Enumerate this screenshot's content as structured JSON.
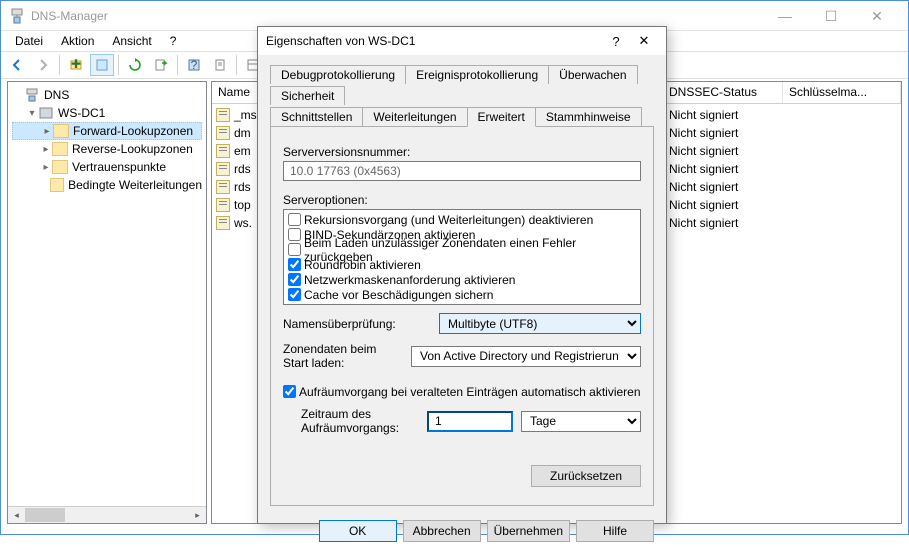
{
  "window": {
    "title": "DNS-Manager",
    "menu": [
      "Datei",
      "Aktion",
      "Ansicht",
      "?"
    ]
  },
  "tree": {
    "root": "DNS",
    "server": "WS-DC1",
    "nodes": [
      {
        "label": "Forward-Lookupzonen",
        "selected": true
      },
      {
        "label": "Reverse-Lookupzonen"
      },
      {
        "label": "Vertrauenspunkte"
      },
      {
        "label": "Bedingte Weiterleitungen"
      }
    ]
  },
  "middle": {
    "header": "Name",
    "rows": [
      "_ms",
      "dm",
      "em",
      "rds",
      "rds",
      "top",
      "ws."
    ]
  },
  "right": {
    "col1": "DNSSEC-Status",
    "col2": "Schlüsselma...",
    "rows": [
      "Nicht signiert",
      "Nicht signiert",
      "Nicht signiert",
      "Nicht signiert",
      "Nicht signiert",
      "Nicht signiert",
      "Nicht signiert"
    ]
  },
  "dialog": {
    "title": "Eigenschaften von WS-DC1",
    "tabs_row1": [
      "Debugprotokollierung",
      "Ereignisprotokollierung",
      "Überwachen",
      "Sicherheit"
    ],
    "tabs_row2": [
      "Schnittstellen",
      "Weiterleitungen",
      "Erweitert",
      "Stammhinweise"
    ],
    "active_tab": "Erweitert",
    "version_label": "Serverversionsnummer:",
    "version_value": "10.0 17763 (0x4563)",
    "options_label": "Serveroptionen:",
    "options": [
      {
        "label": "Rekursionsvorgang (und Weiterleitungen) deaktivieren",
        "checked": false
      },
      {
        "label": "BIND-Sekundärzonen aktivieren",
        "checked": false
      },
      {
        "label": "Beim Laden unzulässiger Zonendaten einen Fehler zurückgeben",
        "checked": false
      },
      {
        "label": "Roundrobin aktivieren",
        "checked": true
      },
      {
        "label": "Netzwerkmaskenanforderung aktivieren",
        "checked": true
      },
      {
        "label": "Cache vor Beschädigungen sichern",
        "checked": true
      }
    ],
    "namecheck_label": "Namensüberprüfung:",
    "namecheck_value": "Multibyte (UTF8)",
    "zonedata_label": "Zonendaten beim Start laden:",
    "zonedata_value": "Von Active Directory und Registrierun",
    "scavenge_label": "Aufräumvorgang bei veralteten Einträgen automatisch aktivieren",
    "scavenge_checked": true,
    "period_label": "Zeitraum des Aufräumvorgangs:",
    "period_value": "1",
    "period_unit": "Tage",
    "reset_label": "Zurücksetzen",
    "buttons": {
      "ok": "OK",
      "cancel": "Abbrechen",
      "apply": "Übernehmen",
      "help": "Hilfe"
    }
  }
}
